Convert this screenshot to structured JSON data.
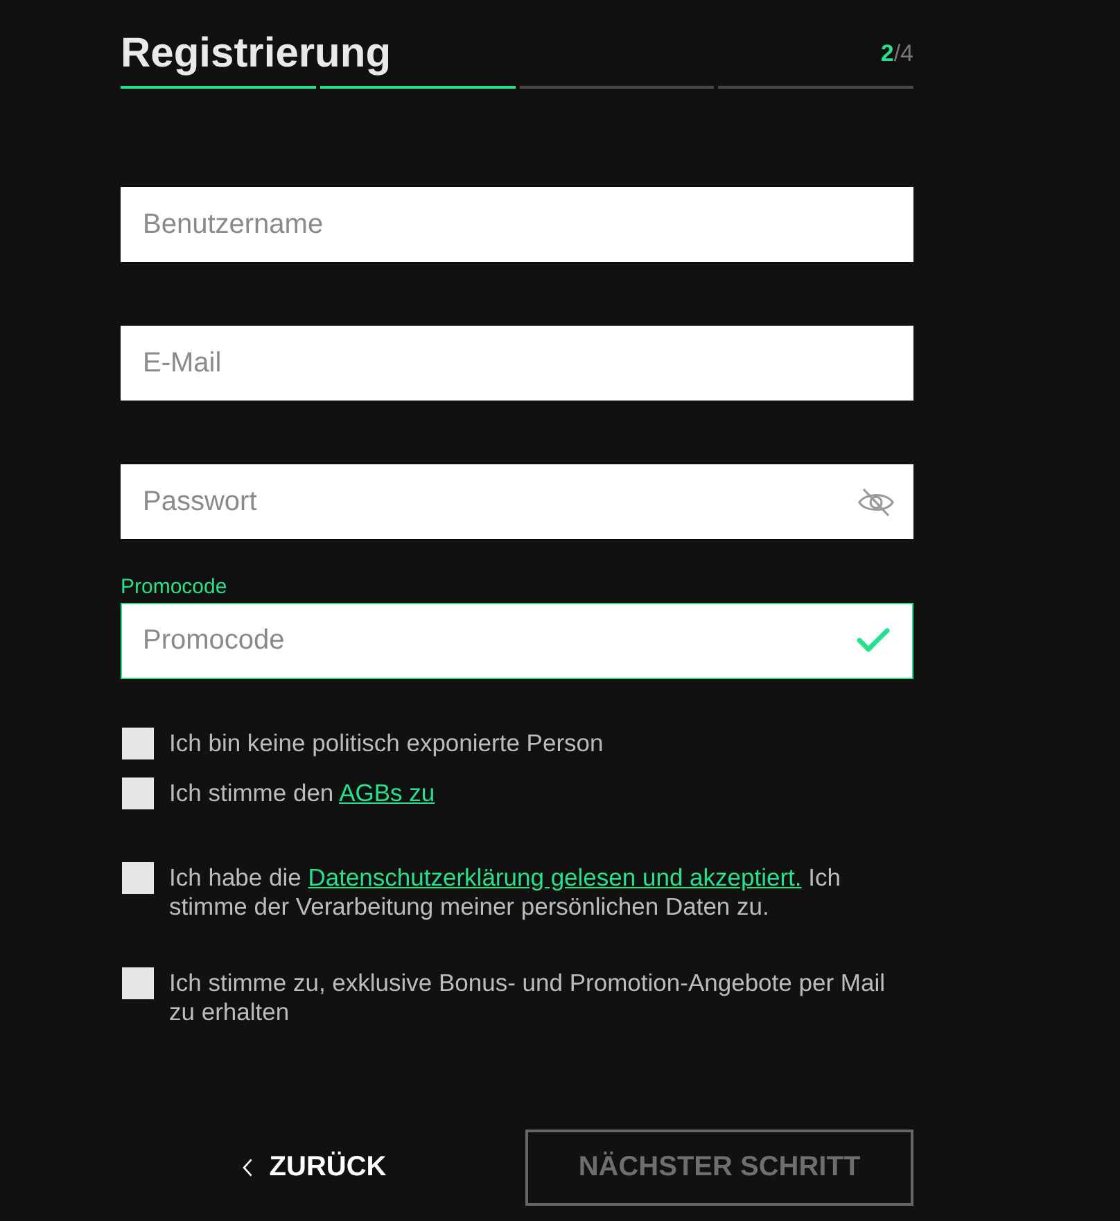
{
  "header": {
    "title": "Registrierung",
    "step_current": "2",
    "step_total": "/4",
    "progress": [
      {
        "complete": true
      },
      {
        "complete": true
      },
      {
        "complete": false
      },
      {
        "complete": false
      }
    ]
  },
  "fields": [
    {
      "kind": "username",
      "placeholder": "Benutzername"
    },
    {
      "kind": "email",
      "placeholder": "E-Mail"
    },
    {
      "kind": "password",
      "placeholder": "Passwort"
    },
    {
      "kind": "promo",
      "label": "Promocode",
      "placeholder": "Promocode",
      "valid": true
    }
  ],
  "consents": [
    {
      "checked": false,
      "text": "Ich bin keine politisch exponierte Person"
    },
    {
      "checked": false,
      "text": "Ich stimme den ",
      "link": "AGBs zu"
    },
    {
      "checked": false,
      "text": "Ich habe die ",
      "link": "Datenschutzerklärung gelesen und akzeptiert.",
      "text_after": " Ich stimme der Verarbeitung meiner persönlichen Daten zu."
    },
    {
      "checked": false,
      "text": "Ich stimme zu, exklusive Bonus- und Promotion-Angebote per Mail zu erhalten"
    }
  ],
  "buttons": [
    {
      "kind": "back",
      "label": "ZURÜCK",
      "disabled": false
    },
    {
      "kind": "next",
      "label": "NÄCHSTER SCHRITT",
      "disabled": true
    }
  ]
}
